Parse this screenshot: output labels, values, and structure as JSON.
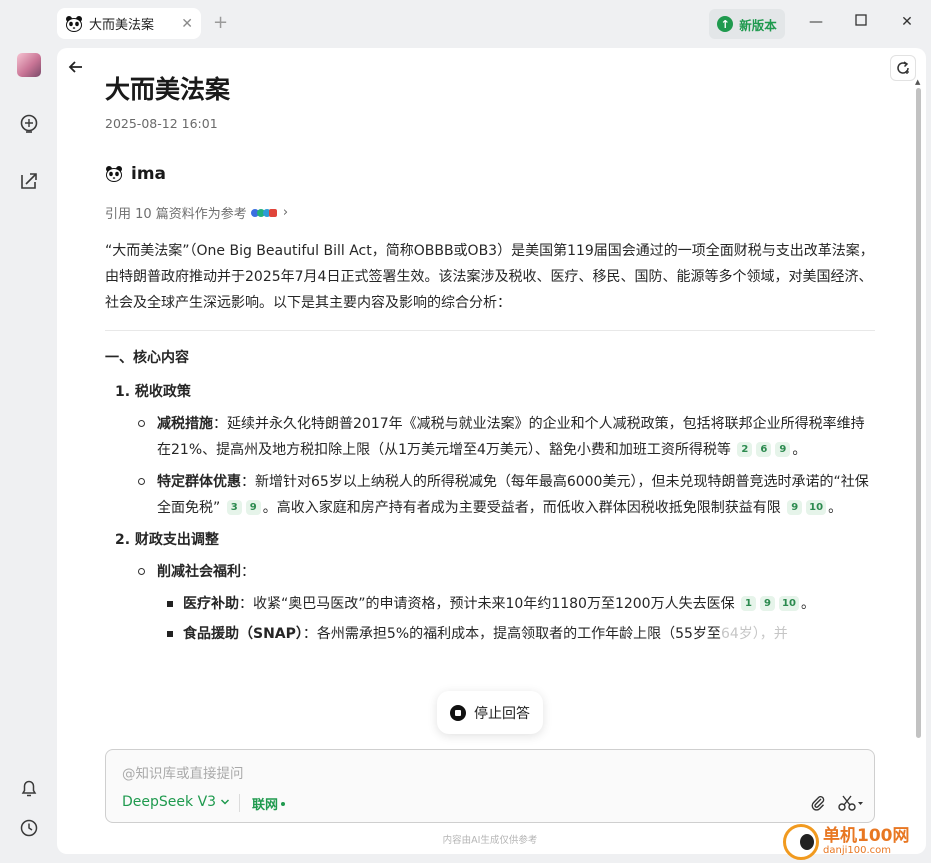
{
  "titlebar": {
    "tab_title": "大而美法案",
    "new_version_label": "新版本"
  },
  "doc": {
    "title": "大而美法案",
    "date": "2025-08-12 16:01",
    "assistant_name": "ima",
    "citation_text": "引用 10 篇资料作为参考"
  },
  "article": {
    "intro": "“大而美法案”（One Big Beautiful Bill Act，简称OBBB或OB3）是美国第119届国会通过的一项全面财税与支出改革法案，由特朗普政府推动并于2025年7月4日正式签署生效。该法案涉及税收、医疗、移民、国防、能源等多个领域，对美国经济、社会及全球产生深远影响。以下是其主要内容及影响的综合分析：",
    "section1_heading": "一、核心内容",
    "item1_label": "1. 税收政策",
    "b1_lead": "减税措施",
    "b1_text": "：延续并永久化特朗普2017年《减税与就业法案》的企业和个人减税政策，包括将联邦企业所得税率维持在21%、提高州及地方税扣除上限（从1万美元增至4万美元）、豁免小费和加班工资所得税等",
    "b1_refs": [
      "2",
      "6",
      "9"
    ],
    "b1_end": "。",
    "b2_lead": "特定群体优惠",
    "b2_text": "：新增针对65岁以上纳税人的所得税减免（每年最高6000美元），但未兑现特朗普竞选时承诺的“社保全面免税”",
    "b2_refs_a": [
      "3",
      "9"
    ],
    "b2_text2": "。高收入家庭和房产持有者成为主要受益者，而低收入群体因税收抵免限制获益有限",
    "b2_refs_b": [
      "9",
      "10"
    ],
    "b2_end": "。",
    "item2_label": "2. 财政支出调整",
    "b3_lead": "削减社会福利",
    "b3_end": "：",
    "s1_lead": "医疗补助",
    "s1_text": "：收紧“奥巴马医改”的申请资格，预计未来10年约1180万至1200万人失去医保",
    "s1_refs": [
      "1",
      "9",
      "10"
    ],
    "s1_end": "。",
    "s2_lead": "食品援助（SNAP）",
    "s2_text": "：各州需承担5%的福利成本，提高领取者的工作年龄上限（55岁至",
    "s2_fade": "64岁），并"
  },
  "stop_button": "停止回答",
  "composer": {
    "placeholder": "@知识库或直接提问",
    "model": "DeepSeek V3",
    "network": "联网"
  },
  "disclaimer": "内容由AI生成仅供参考",
  "watermark": {
    "cn": "单机100网",
    "en": "danji100.com"
  }
}
